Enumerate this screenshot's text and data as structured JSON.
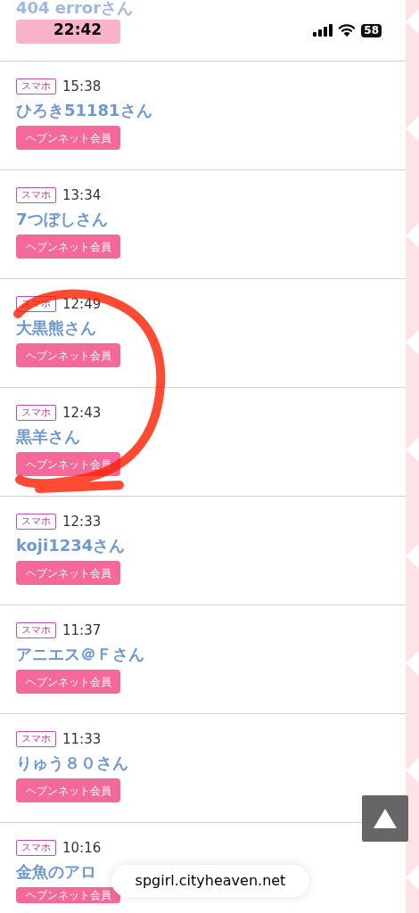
{
  "status_bar": {
    "time": "22:42",
    "battery": "58"
  },
  "partial_entry": {
    "name": "404 errorさん"
  },
  "entries": [
    {
      "device": "スマホ",
      "time": "15:38",
      "name": "ひろき51181さん",
      "badge": "ヘブンネット会員"
    },
    {
      "device": "スマホ",
      "time": "13:34",
      "name": "7つぼしさん",
      "badge": "ヘブンネット会員"
    },
    {
      "device": "スマホ",
      "time": "12:49",
      "name": "大黒熊さん",
      "badge": "ヘブンネット会員"
    },
    {
      "device": "スマホ",
      "time": "12:43",
      "name": "黒羊さん",
      "badge": "ヘブンネット会員"
    },
    {
      "device": "スマホ",
      "time": "12:33",
      "name": "koji1234さん",
      "badge": "ヘブンネット会員"
    },
    {
      "device": "スマホ",
      "time": "11:37",
      "name": "アニエス＠Ｆさん",
      "badge": "ヘブンネット会員"
    },
    {
      "device": "スマホ",
      "time": "11:33",
      "name": "りゅう８０さん",
      "badge": "ヘブンネット会員"
    },
    {
      "device": "スマホ",
      "time": "10:16",
      "name": "金魚のアロ",
      "badge": "ヘブンネット会員"
    }
  ],
  "url_bar": {
    "text": "spgirl.cityheaven.net"
  }
}
